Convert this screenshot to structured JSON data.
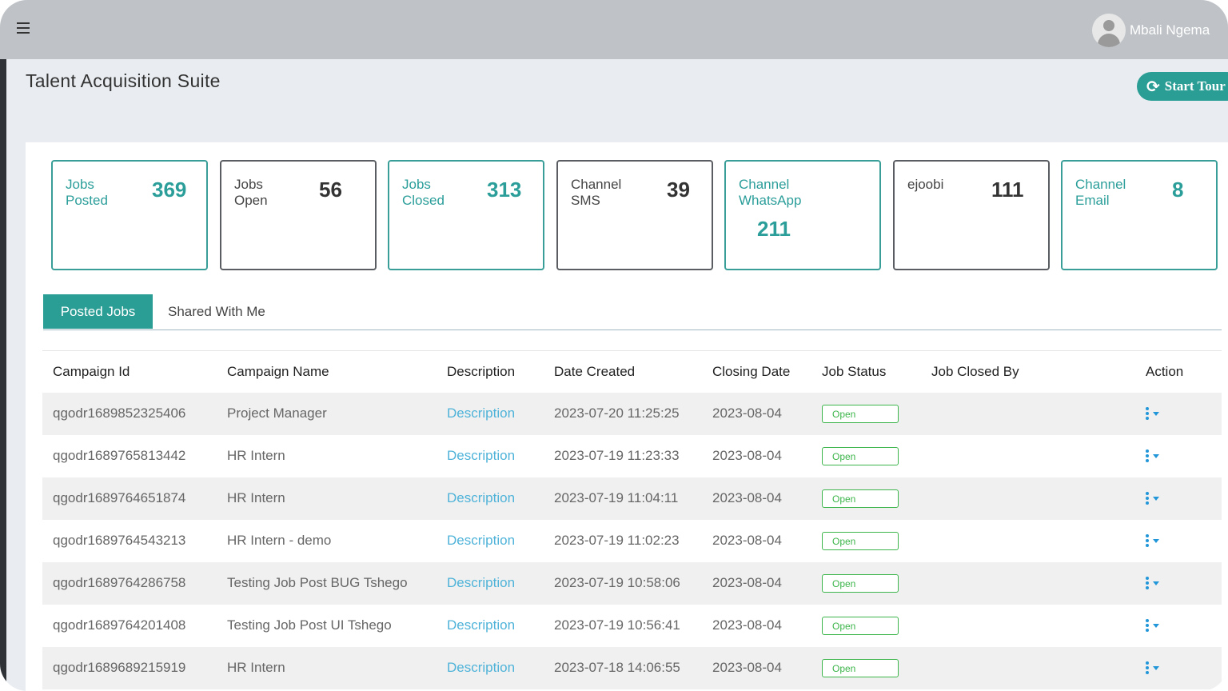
{
  "header": {
    "menu_icon": "hamburger-icon",
    "user_name": "Mbali Ngema"
  },
  "page": {
    "title": "Talent Acquisition Suite",
    "tour_button": "Start Tour",
    "tour_icon": "refresh-icon"
  },
  "stats": [
    {
      "label_line1": "Jobs",
      "label_line2": "Posted",
      "value": "369"
    },
    {
      "label_line1": "Jobs",
      "label_line2": "Open",
      "value": "56"
    },
    {
      "label_line1": "Jobs",
      "label_line2": "Closed",
      "value": "313"
    },
    {
      "label_line1": "Channel",
      "label_line2": "SMS",
      "value": "39"
    },
    {
      "label_line1": "Channel",
      "label_line2": "WhatsApp",
      "value": "211"
    },
    {
      "label_line1": "ejoobi",
      "label_line2": "",
      "value": "111"
    },
    {
      "label_line1": "Channel",
      "label_line2": "Email",
      "value": "8"
    }
  ],
  "tabs": {
    "posted": "Posted Jobs",
    "shared": "Shared With Me"
  },
  "table": {
    "headers": [
      "Campaign Id",
      "Campaign Name",
      "Description",
      "Date Created",
      "Closing Date",
      "Job Status",
      "Job Closed By",
      "Action"
    ],
    "rows": [
      {
        "id": "qgodr1689852325406",
        "name": "Project Manager",
        "desc": "Description",
        "created": "2023-07-20 11:25:25",
        "closing": "2023-08-04",
        "status": "Open",
        "closed_by": ""
      },
      {
        "id": "qgodr1689765813442",
        "name": "HR Intern",
        "desc": "Description",
        "created": "2023-07-19 11:23:33",
        "closing": "2023-08-04",
        "status": "Open",
        "closed_by": ""
      },
      {
        "id": "qgodr1689764651874",
        "name": "HR Intern",
        "desc": "Description",
        "created": "2023-07-19 11:04:11",
        "closing": "2023-08-04",
        "status": "Open",
        "closed_by": ""
      },
      {
        "id": "qgodr1689764543213",
        "name": "HR Intern - demo",
        "desc": "Description",
        "created": "2023-07-19 11:02:23",
        "closing": "2023-08-04",
        "status": "Open",
        "closed_by": ""
      },
      {
        "id": "qgodr1689764286758",
        "name": "Testing Job Post BUG Tshego",
        "desc": "Description",
        "created": "2023-07-19 10:58:06",
        "closing": "2023-08-04",
        "status": "Open",
        "closed_by": ""
      },
      {
        "id": "qgodr1689764201408",
        "name": "Testing Job Post UI Tshego",
        "desc": "Description",
        "created": "2023-07-19 10:56:41",
        "closing": "2023-08-04",
        "status": "Open",
        "closed_by": ""
      },
      {
        "id": "qgodr1689689215919",
        "name": "HR Intern",
        "desc": "Description",
        "created": "2023-07-18 14:06:55",
        "closing": "2023-08-04",
        "status": "Open",
        "closed_by": ""
      }
    ]
  },
  "colors": {
    "accent": "#2a9d94",
    "link": "#4fb3d9",
    "status_open": "#3cb54a",
    "topbar": "#bfc3c7"
  }
}
